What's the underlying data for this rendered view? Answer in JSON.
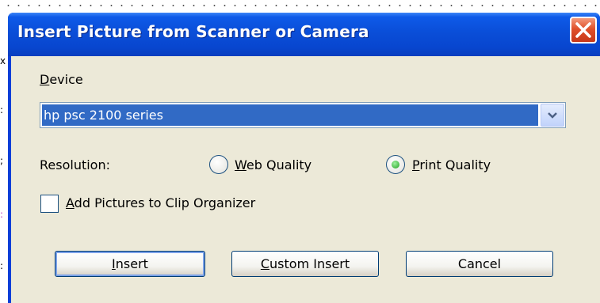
{
  "dialog": {
    "title": "Insert Picture from Scanner or Camera",
    "device_label_mnemonic": "D",
    "device_label_rest": "evice",
    "device_selected": "hp psc 2100 series",
    "resolution_label": "Resolution:",
    "web_quality_mnemonic": "W",
    "web_quality_rest": "eb Quality",
    "web_quality_selected": false,
    "print_quality_mnemonic": "P",
    "print_quality_rest": "rint Quality",
    "print_quality_selected": true,
    "add_to_organizer_mnemonic": "A",
    "add_to_organizer_rest": "dd Pictures to Clip Organizer",
    "add_to_organizer_checked": false,
    "buttons": {
      "insert_mnemonic": "I",
      "insert_rest": "nsert",
      "custom_insert_mnemonic": "C",
      "custom_insert_rest": "ustom Insert",
      "cancel": "Cancel"
    }
  },
  "colors": {
    "titlebar": "#0a4ed8",
    "client_bg": "#ece9d8",
    "selection": "#316ac5",
    "close_button": "#e0502a",
    "radio_dot": "#21a121"
  },
  "icons": {
    "close": "close-icon",
    "dropdown": "chevron-down-icon"
  }
}
